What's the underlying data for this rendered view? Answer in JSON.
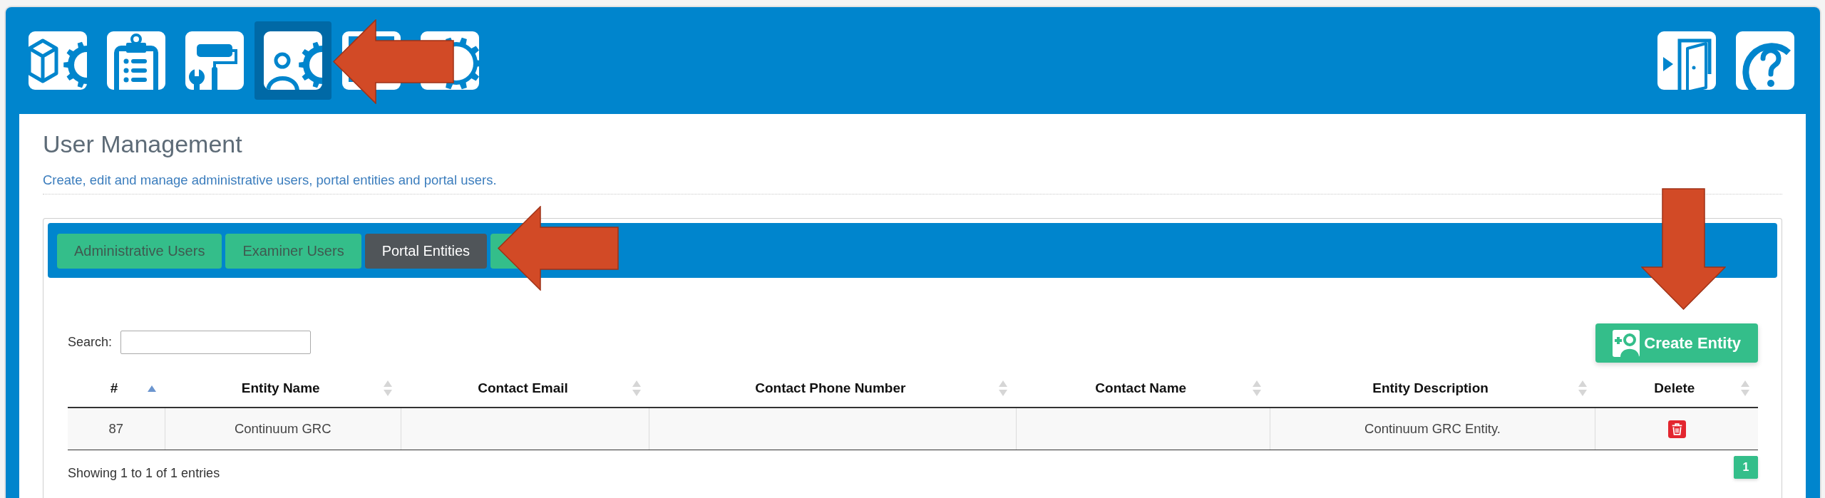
{
  "toolbar": {
    "items": [
      {
        "selected": false
      },
      {
        "selected": false
      },
      {
        "selected": false
      },
      {
        "selected": true
      },
      {
        "selected": false
      },
      {
        "selected": false
      }
    ]
  },
  "page": {
    "title": "User Management",
    "subtitle": "Create, edit and manage administrative users, portal entities and portal users."
  },
  "tabs": [
    {
      "label": "Administrative Users",
      "selected": false
    },
    {
      "label": "Examiner Users",
      "selected": false
    },
    {
      "label": "Portal Entities",
      "selected": true
    },
    {
      "selected": false
    }
  ],
  "search": {
    "label": "Search:"
  },
  "create_button": {
    "label": "Create Entity"
  },
  "table": {
    "columns": [
      {
        "label": "#",
        "kind": "text",
        "sorted": true
      },
      {
        "label": "Entity Name",
        "kind": "text",
        "sorted": false
      },
      {
        "label": "Contact Email",
        "kind": "text",
        "sorted": false
      },
      {
        "label": "Contact Phone Number",
        "kind": "text",
        "sorted": false
      },
      {
        "label": "Contact Name",
        "kind": "text",
        "sorted": false
      },
      {
        "label": "Entity Description",
        "kind": "text",
        "sorted": false
      },
      {
        "label": "Delete",
        "kind": "delete",
        "sorted": false
      }
    ],
    "rows": [
      {
        "number": "87",
        "entity_name": "Continuum GRC",
        "entity_description": "Continuum GRC Entity."
      }
    ]
  },
  "footer": {
    "info": "Showing 1 to 1 of 1 entries",
    "pages": [
      {
        "label": "1",
        "selected": true
      }
    ]
  },
  "annotations": [
    {
      "kind": "left_arrow"
    },
    {
      "kind": "left_arrow"
    },
    {
      "kind": "down_arrow"
    }
  ]
}
